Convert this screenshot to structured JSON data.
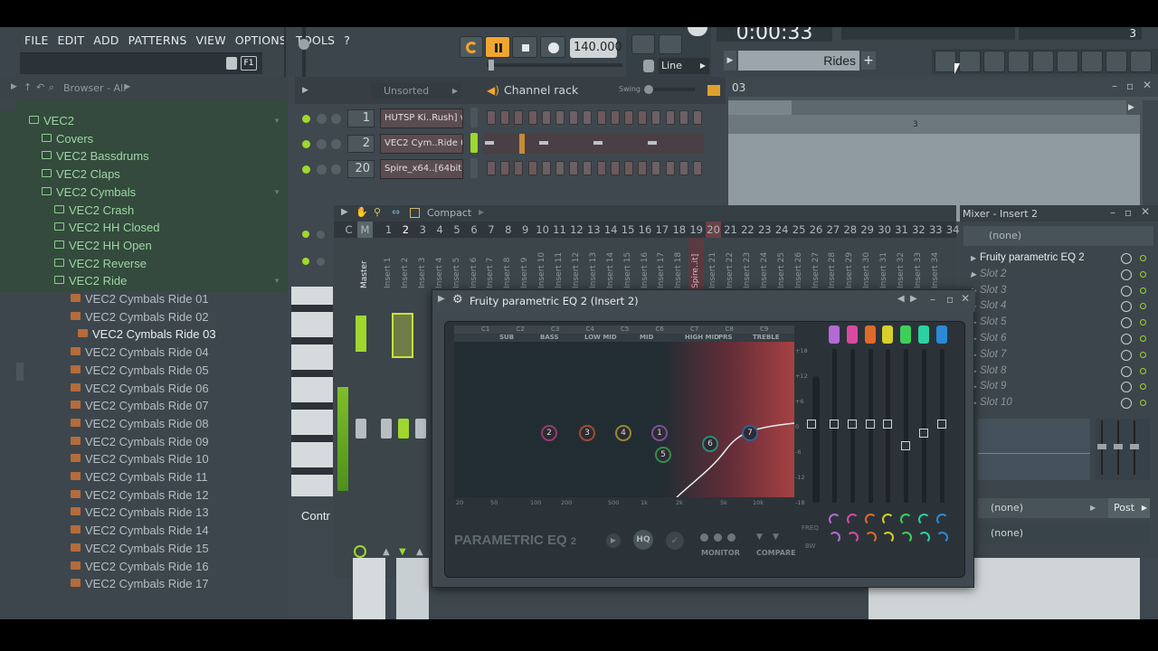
{
  "menu": [
    "FILE",
    "EDIT",
    "ADD",
    "PATTERNS",
    "VIEW",
    "OPTIONS",
    "TOOLS",
    "?"
  ],
  "transport": {
    "tempo": "140.000",
    "time": "0:00:33",
    "snap": "Line",
    "pattern_name": "Rides",
    "pattern_no": "3"
  },
  "browser": {
    "title": "Browser - All",
    "items": [
      {
        "label": "VEC2",
        "kind": "folder",
        "indent": 1
      },
      {
        "label": "Covers",
        "kind": "folder",
        "indent": 2
      },
      {
        "label": "VEC2 Bassdrums",
        "kind": "folder",
        "indent": 2
      },
      {
        "label": "VEC2 Claps",
        "kind": "folder",
        "indent": 2
      },
      {
        "label": "VEC2 Cymbals",
        "kind": "folder",
        "indent": 2
      },
      {
        "label": "VEC2 Crash",
        "kind": "folder",
        "indent": 3
      },
      {
        "label": "VEC2 HH Closed",
        "kind": "folder",
        "indent": 3
      },
      {
        "label": "VEC2 HH Open",
        "kind": "folder",
        "indent": 3
      },
      {
        "label": "VEC2 Reverse",
        "kind": "folder",
        "indent": 3
      },
      {
        "label": "VEC2 Ride",
        "kind": "folder",
        "indent": 3
      },
      {
        "label": "VEC2 Cymbals Ride 01",
        "kind": "file",
        "indent": 4
      },
      {
        "label": "VEC2 Cymbals Ride 02",
        "kind": "file",
        "indent": 4
      },
      {
        "label": "VEC2 Cymbals Ride 03",
        "kind": "file",
        "indent": 4,
        "selected": true
      },
      {
        "label": "VEC2 Cymbals Ride 04",
        "kind": "file",
        "indent": 4
      },
      {
        "label": "VEC2 Cymbals Ride 05",
        "kind": "file",
        "indent": 4
      },
      {
        "label": "VEC2 Cymbals Ride 06",
        "kind": "file",
        "indent": 4
      },
      {
        "label": "VEC2 Cymbals Ride 07",
        "kind": "file",
        "indent": 4
      },
      {
        "label": "VEC2 Cymbals Ride 08",
        "kind": "file",
        "indent": 4
      },
      {
        "label": "VEC2 Cymbals Ride 09",
        "kind": "file",
        "indent": 4
      },
      {
        "label": "VEC2 Cymbals Ride 10",
        "kind": "file",
        "indent": 4
      },
      {
        "label": "VEC2 Cymbals Ride 11",
        "kind": "file",
        "indent": 4
      },
      {
        "label": "VEC2 Cymbals Ride 12",
        "kind": "file",
        "indent": 4
      },
      {
        "label": "VEC2 Cymbals Ride 13",
        "kind": "file",
        "indent": 4
      },
      {
        "label": "VEC2 Cymbals Ride 14",
        "kind": "file",
        "indent": 4
      },
      {
        "label": "VEC2 Cymbals Ride 15",
        "kind": "file",
        "indent": 4
      },
      {
        "label": "VEC2 Cymbals Ride 16",
        "kind": "file",
        "indent": 4
      },
      {
        "label": "VEC2 Cymbals Ride 17",
        "kind": "file",
        "indent": 4
      }
    ]
  },
  "channel_rack": {
    "title": "Channel rack",
    "filter": "Unsorted",
    "swing_label": "Swing",
    "channels": [
      {
        "num": "1",
        "name": "HUTSP Ki..Rush] v5"
      },
      {
        "num": "2",
        "name": "VEC2 Cym..Ride 03"
      },
      {
        "num": "20",
        "name": "Spire_x64..[64bit]"
      }
    ]
  },
  "playlist": {
    "title": "03",
    "bar": "3"
  },
  "mixer": {
    "mode": "Compact",
    "tracks": [
      "C",
      "M",
      "1",
      "2",
      "3",
      "4",
      "5",
      "6",
      "7",
      "8",
      "9",
      "10",
      "11",
      "12",
      "13",
      "14",
      "15",
      "16",
      "17",
      "18",
      "19",
      "20",
      "21",
      "22",
      "23",
      "24",
      "25",
      "26",
      "27",
      "28",
      "29",
      "30",
      "31",
      "32",
      "33",
      "34"
    ],
    "labels": [
      "Master",
      "Insert 1",
      "Insert 2",
      "Insert 3",
      "Insert 4",
      "Insert 5",
      "Insert 6",
      "Insert 7",
      "Insert 8",
      "Insert 9",
      "Insert 10",
      "Insert 11",
      "Insert 12",
      "Insert 13",
      "Insert 14",
      "Insert 15",
      "Insert 16",
      "Insert 17",
      "Insert 18",
      "Spire..it]",
      "Insert 21",
      "Insert 22",
      "Insert 23",
      "Insert 24",
      "Insert 25",
      "Insert 26",
      "Insert 27",
      "Insert 28",
      "Insert 29",
      "Insert 30",
      "Insert 31",
      "Insert 32",
      "Insert 33",
      "Insert 34"
    ],
    "contr_label": "Contr"
  },
  "mixer_insert": {
    "title": "Mixer - Insert 2",
    "input": "(none)",
    "slots": [
      "Fruity parametric EQ 2",
      "Slot 2",
      "Slot 3",
      "Slot 4",
      "Slot 5",
      "Slot 6",
      "Slot 7",
      "Slot 8",
      "Slot 9",
      "Slot 10"
    ],
    "out1": "(none)",
    "post": "Post",
    "out2": "(none)"
  },
  "eq": {
    "title": "Fruity parametric EQ 2 (Insert 2)",
    "notes": [
      "C1",
      "C2",
      "C3",
      "C4",
      "C5",
      "C6",
      "C7",
      "C8",
      "C9"
    ],
    "ranges": [
      "SUB",
      "BASS",
      "LOW MID",
      "MID",
      "HIGH MID",
      "PRS",
      "TREBLE"
    ],
    "db_ticks": [
      "+18",
      "+12",
      "+6",
      "0",
      "-6",
      "-12",
      "-18"
    ],
    "freq_ticks": [
      "20",
      "50",
      "100",
      "200",
      "500",
      "1k",
      "2k",
      "5k",
      "10k"
    ],
    "bands": [
      "1",
      "2",
      "3",
      "4",
      "5",
      "6",
      "7"
    ],
    "band_colors": [
      "#b36ad6",
      "#d84aa0",
      "#e06a2a",
      "#d7cf2a",
      "#3ecf5a",
      "#2dd0a0",
      "#2a8ad8"
    ],
    "brand": "PARAMETRIC EQ",
    "brand_suffix": "2",
    "hq": "HQ",
    "monitor": "MONITOR",
    "compare": "COMPARE",
    "freq_label": "FREQ",
    "bw_label": "BW"
  }
}
